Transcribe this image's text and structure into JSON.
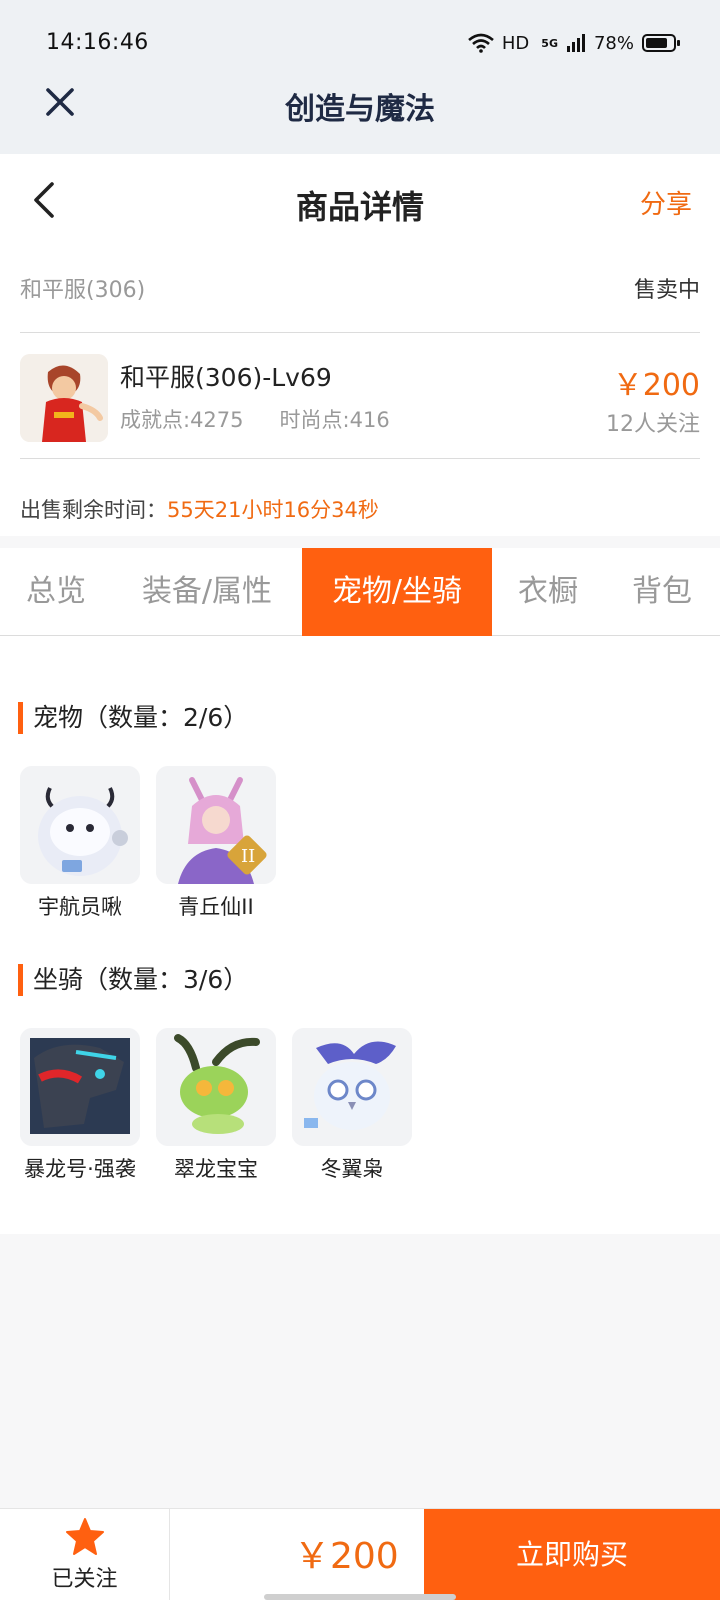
{
  "status": {
    "time": "14:16:46",
    "hd": "HD",
    "net": "5G",
    "battery": "78%"
  },
  "appbar": {
    "title": "创造与魔法"
  },
  "nav": {
    "title": "商品详情",
    "share": "分享"
  },
  "server": {
    "name": "和平服(306)",
    "status": "售卖中"
  },
  "item": {
    "name": "和平服(306)-Lv69",
    "achievement": "成就点:4275",
    "fashion": "时尚点:416",
    "price": "￥200",
    "followers": "12人关注"
  },
  "remain": {
    "label": "出售剩余时间：",
    "value": "55天21小时16分34秒"
  },
  "tabs": [
    "总览",
    "装备/属性",
    "宠物/坐骑",
    "衣橱",
    "背包"
  ],
  "pets": {
    "title": "宠物（数量：2/6）",
    "items": [
      "宇航员啾",
      "青丘仙II"
    ]
  },
  "mounts": {
    "title": "坐骑（数量：3/6）",
    "items": [
      "暴龙号·强袭",
      "翠龙宝宝",
      "冬翼枭"
    ]
  },
  "bottom": {
    "follow": "已关注",
    "price": "￥200",
    "buy": "立即购买"
  },
  "colors": {
    "accent": "#ff6010",
    "price": "#f06a12"
  }
}
